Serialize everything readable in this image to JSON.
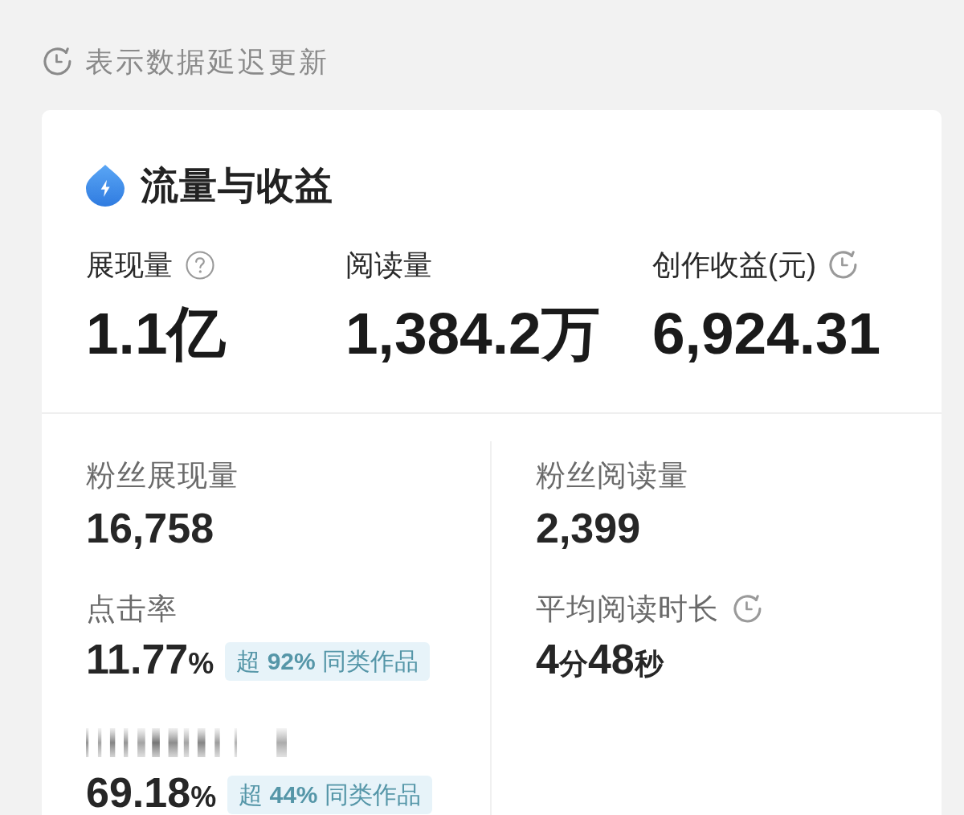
{
  "notice": {
    "text": "表示数据延迟更新"
  },
  "card": {
    "title": "流量与收益",
    "metrics": [
      {
        "label": "展现量",
        "value": "1.1亿",
        "help": true,
        "delayed": false
      },
      {
        "label": "阅读量",
        "value": "1,384.2万",
        "help": false,
        "delayed": false
      },
      {
        "label": "创作收益(元)",
        "value": "6,924.31",
        "help": false,
        "delayed": true
      }
    ],
    "details": {
      "columns": [
        [
          {
            "label": "粉丝展现量",
            "label_obscured": false,
            "value": "16,758",
            "delayed": false
          },
          {
            "label": "点击率",
            "label_obscured": false,
            "value": "11.77%",
            "badge": "超 **92%** 同类作品",
            "delayed": false
          },
          {
            "label_obscured": true,
            "value": "69.18%",
            "badge": "超 **44%** 同类作品",
            "delayed": false
          }
        ],
        [
          {
            "label": "粉丝阅读量",
            "label_obscured": false,
            "value": "2,399",
            "delayed": false
          },
          {
            "label": "平均阅读时长",
            "label_obscured": false,
            "value": "4分48秒",
            "delayed": true
          }
        ]
      ]
    }
  }
}
